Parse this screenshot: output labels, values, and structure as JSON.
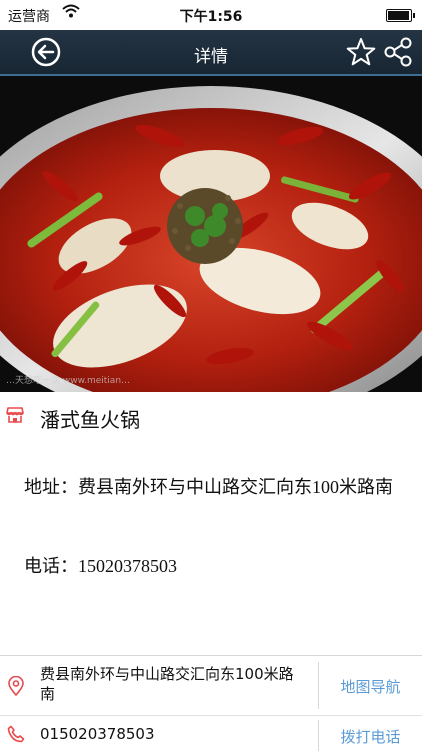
{
  "status_bar": {
    "carrier": "运营商",
    "time": "下午1:56"
  },
  "nav": {
    "title": "详情",
    "icons": [
      "back-icon",
      "star-icon",
      "share-icon"
    ]
  },
  "hero": {
    "watermark": "…天想吃一次 www.meitian…"
  },
  "store": {
    "name": "潘式鱼火锅",
    "address_full": "地址：费县南外环与中山路交汇向东100米路南",
    "phone_full": "电话：15020378503"
  },
  "actions": {
    "address": "费县南外环与中山路交汇向东100米路南",
    "map_label": "地图导航",
    "phone": "015020378503",
    "call_label": "拨打电话"
  },
  "colors": {
    "nav_background": "#1e2d3b",
    "nav_border": "#3c6f93",
    "accent_red": "#e84a4a",
    "action_blue": "#5b9bd5"
  }
}
